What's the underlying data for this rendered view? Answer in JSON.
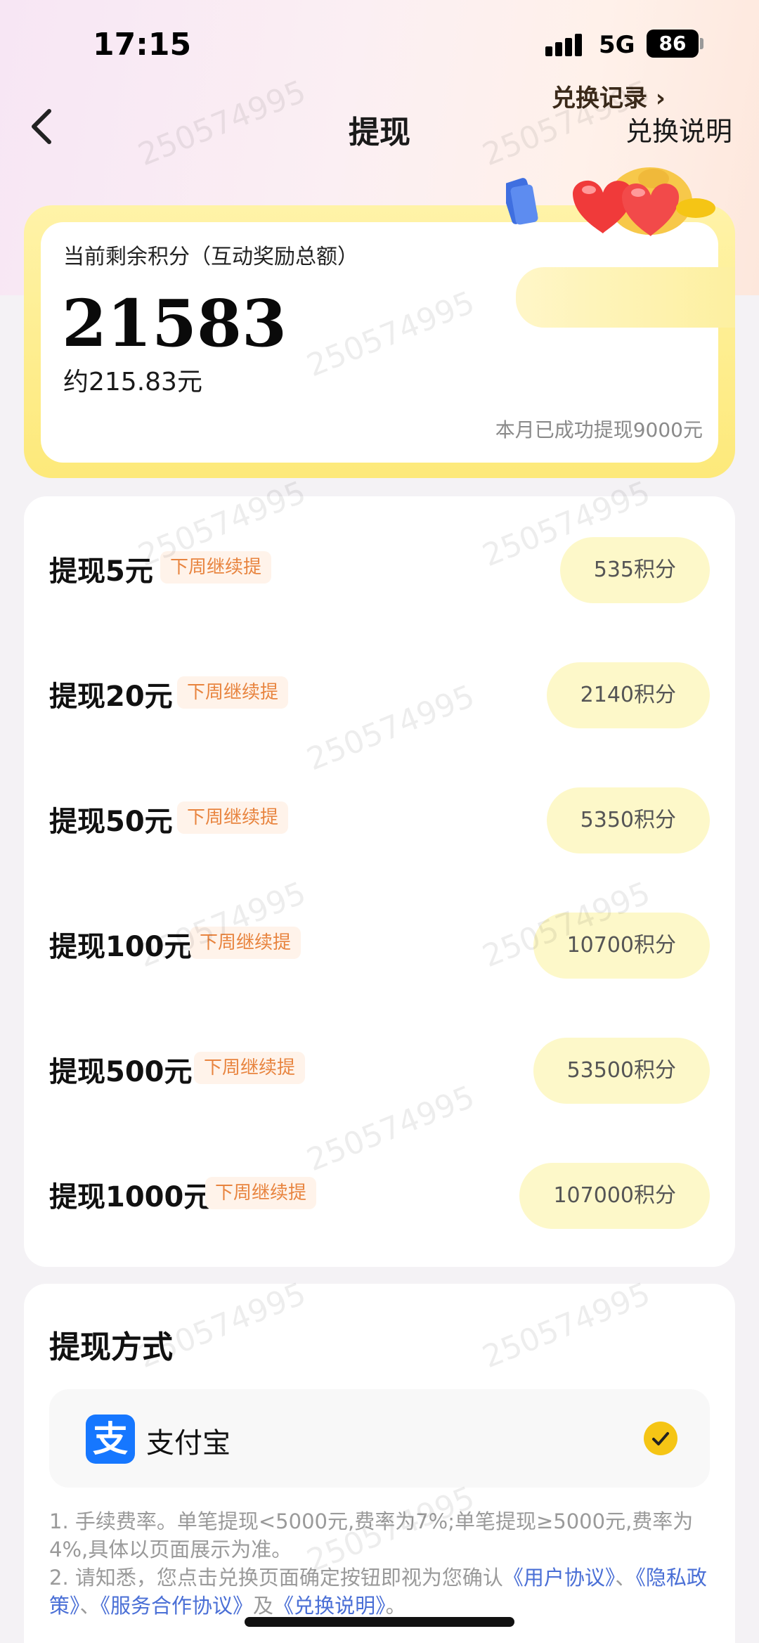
{
  "status_bar": {
    "time": "17:15",
    "network": "5G",
    "battery": "86"
  },
  "nav": {
    "title": "提现",
    "right_label": "兑换说明"
  },
  "points": {
    "label": "当前剩余积分（互动奖励总额）",
    "value": "21583",
    "approx": "约215.83元",
    "month_note": "本月已成功提现9000元",
    "record_label": "兑换记录 ›"
  },
  "options": [
    {
      "title": "提现5元",
      "tag": "下周继续提",
      "cost": "535积分"
    },
    {
      "title": "提现20元",
      "tag": "下周继续提",
      "cost": "2140积分"
    },
    {
      "title": "提现50元",
      "tag": "下周继续提",
      "cost": "5350积分"
    },
    {
      "title": "提现100元",
      "tag": "下周继续提",
      "cost": "10700积分"
    },
    {
      "title": "提现500元",
      "tag": "下周继续提",
      "cost": "53500积分"
    },
    {
      "title": "提现1000元",
      "tag": "下周继续提",
      "cost": "107000积分"
    }
  ],
  "method": {
    "title": "提现方式",
    "alipay_logo": "支",
    "alipay_name": "支付宝"
  },
  "notes": {
    "line1": "1. 手续费率。单笔提现<5000元,费率为7%;单笔提现≥5000元,费率为4%,具体以页面展示为准。",
    "line2_prefix": "2. 请知悉，您点击兑换页面确定按钮即视为您确认",
    "link_user": "《用户协议》",
    "sep1": "、",
    "link_privacy": "《隐私政策》",
    "sep2": "、",
    "link_service": "《服务合作协议》",
    "sep3": "及",
    "link_exchange": "《兑换说明》",
    "end": "。"
  },
  "watermark": "250574995",
  "colors": {
    "accent_yellow": "#f5c515",
    "tag_orange": "#e8843f",
    "link_blue": "#4a6fd6"
  }
}
